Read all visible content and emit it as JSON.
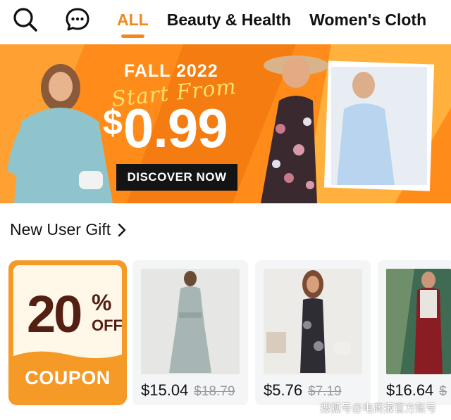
{
  "nav": {
    "search_icon": "search-icon",
    "chat_icon": "chat-icon",
    "tabs": [
      {
        "label": "ALL",
        "active": true
      },
      {
        "label": "Beauty & Health",
        "active": false
      },
      {
        "label": "Women's Cloth",
        "active": false
      }
    ],
    "accent_color": "#f08a1d"
  },
  "banner": {
    "headline": "FALL 2022",
    "subline": "Start From",
    "price_symbol": "$",
    "price": "0.99",
    "cta": "DISCOVER NOW",
    "background_color": "#ff8c1a"
  },
  "section": {
    "title": "New User Gift",
    "chevron_icon": "chevron-right-icon"
  },
  "coupon": {
    "percent": "20",
    "percent_sign": "%",
    "off": "OFF",
    "label": "COUPON"
  },
  "products": [
    {
      "price": "$15.04",
      "old_price": "$18.79"
    },
    {
      "price": "$5.76",
      "old_price": "$7.19"
    },
    {
      "price": "$16.64",
      "old_price": "$"
    }
  ],
  "watermark": "搜狐号@电商报官方账号"
}
